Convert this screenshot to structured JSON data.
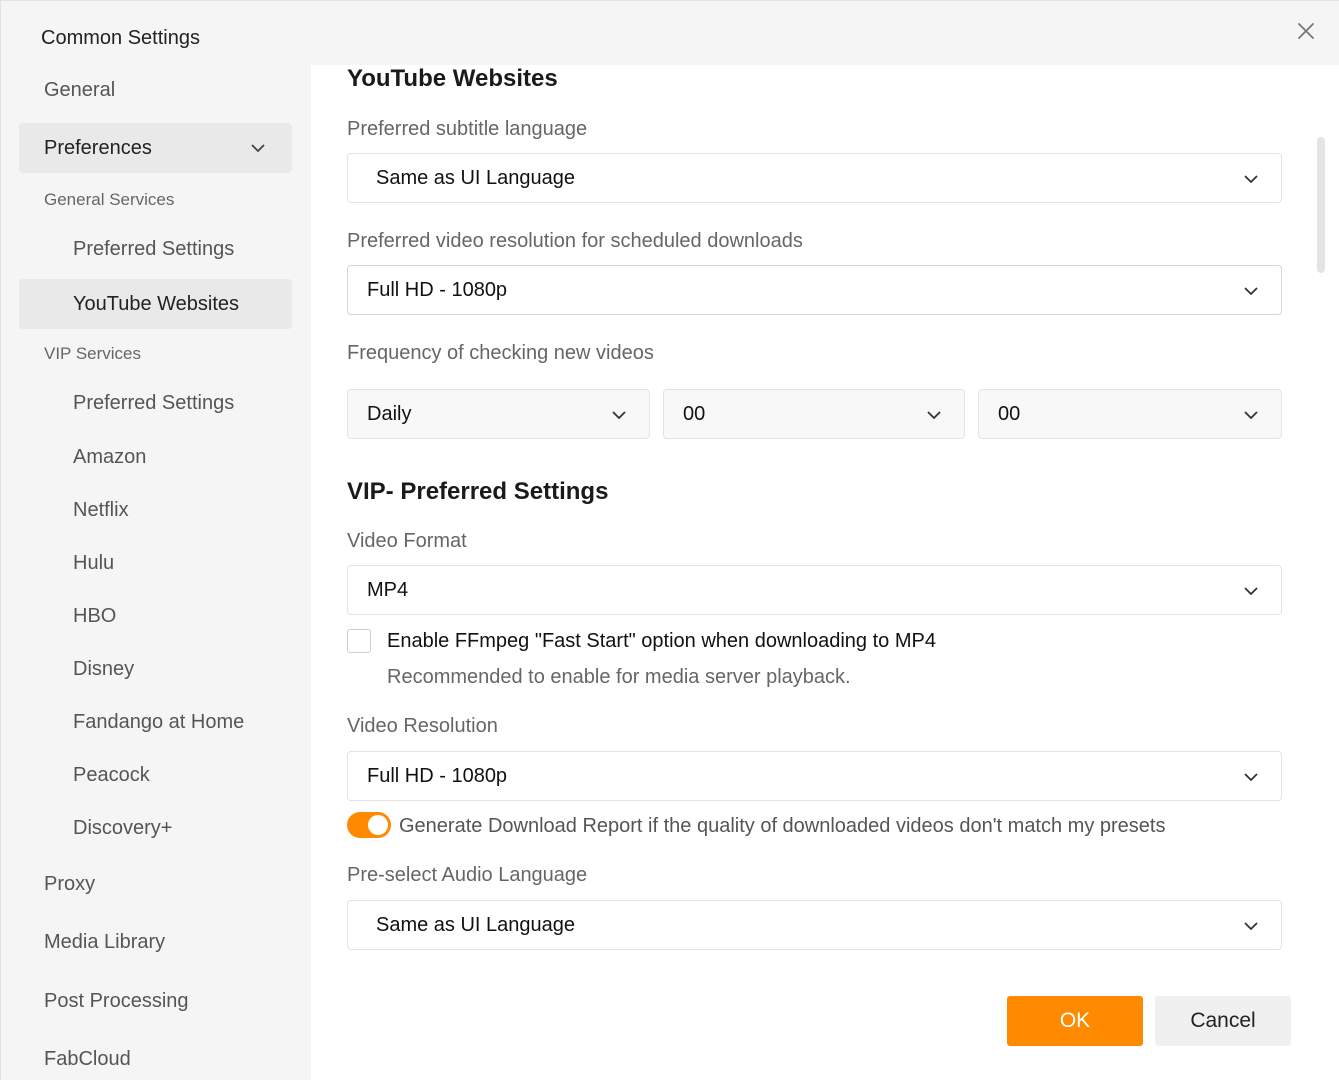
{
  "window": {
    "title": "Common Settings"
  },
  "icons": {
    "close": "close-icon",
    "chevron": "chevron-down-icon"
  },
  "colors": {
    "accent": "#ff8a00",
    "sidebar_bg": "#f5f5f5",
    "active_item_bg": "#e9e9e9"
  },
  "sidebar": {
    "items": [
      {
        "label": "General",
        "kind": "top"
      },
      {
        "label": "Preferences",
        "kind": "top",
        "expanded": true
      },
      {
        "label": "General Services",
        "kind": "group"
      },
      {
        "label": "Preferred Settings",
        "kind": "sub"
      },
      {
        "label": "YouTube Websites",
        "kind": "sub",
        "active": true
      },
      {
        "label": "VIP Services",
        "kind": "group"
      },
      {
        "label": "Preferred Settings",
        "kind": "sub"
      },
      {
        "label": "Amazon",
        "kind": "sub"
      },
      {
        "label": "Netflix",
        "kind": "sub"
      },
      {
        "label": "Hulu",
        "kind": "sub"
      },
      {
        "label": "HBO",
        "kind": "sub"
      },
      {
        "label": "Disney",
        "kind": "sub"
      },
      {
        "label": "Fandango at Home",
        "kind": "sub"
      },
      {
        "label": "Peacock",
        "kind": "sub"
      },
      {
        "label": "Discovery+",
        "kind": "sub"
      },
      {
        "label": "Proxy",
        "kind": "top"
      },
      {
        "label": "Media Library",
        "kind": "top"
      },
      {
        "label": "Post Processing",
        "kind": "top"
      },
      {
        "label": "FabCloud",
        "kind": "top"
      }
    ]
  },
  "youtube": {
    "heading": "YouTube Websites",
    "subtitle_label": "Preferred subtitle language",
    "subtitle_value": "Same as UI Language",
    "resolution_label": "Preferred video resolution for scheduled downloads",
    "resolution_value": "Full HD - 1080p",
    "frequency_label": "Frequency of checking new videos",
    "frequency_value": "Daily",
    "hour_value": "00",
    "minute_value": "00"
  },
  "vip": {
    "heading": "VIP- Preferred Settings",
    "format_label": "Video Format",
    "format_value": "MP4",
    "faststart_label": "Enable FFmpeg \"Fast Start\" option when downloading to MP4",
    "faststart_checked": false,
    "faststart_hint": "Recommended to enable for media server playback.",
    "resolution_label": "Video Resolution",
    "resolution_value": "Full HD - 1080p",
    "report_label": "Generate Download Report if the quality of downloaded videos don't match my presets",
    "report_enabled": true,
    "audio_label": "Pre-select Audio Language",
    "audio_value": "Same as UI Language"
  },
  "buttons": {
    "ok": "OK",
    "cancel": "Cancel"
  }
}
